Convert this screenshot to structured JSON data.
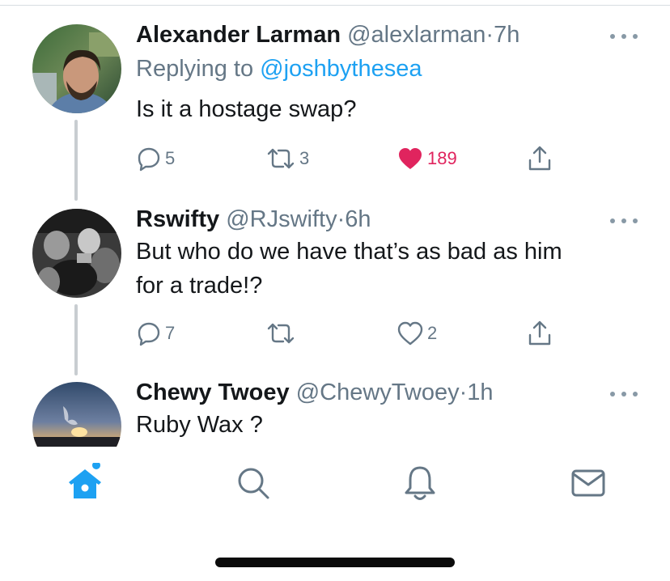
{
  "tweets": [
    {
      "name": "Alexander Larman",
      "handle": "@alexlarman",
      "separator": "·",
      "time": "7h",
      "replying_label": "Replying to",
      "replying_to": "@joshbythesea",
      "text": "Is it a hostage swap?",
      "replies": "5",
      "retweets": "3",
      "likes": "189",
      "liked": true,
      "avatar_icon": "person-photo-avatar"
    },
    {
      "name": "Rswifty",
      "handle": "@RJswifty",
      "separator": "·",
      "time": "6h",
      "text_line1": "But who do we have that’s as bad as him",
      "text_line2": "for a trade!?",
      "replies": "7",
      "retweets": "",
      "likes": "2",
      "liked": false,
      "avatar_icon": "grayscale-photo-avatar"
    },
    {
      "name": "Chewy Twoey",
      "handle": "@ChewyTwoey",
      "separator": "·",
      "time": "1h",
      "text": "Ruby Wax ?",
      "avatar_icon": "sunset-photo-avatar"
    }
  ],
  "tabbar": {
    "items": [
      "home-icon",
      "search-icon",
      "notifications-icon",
      "messages-icon"
    ],
    "active": "home-icon",
    "has_new_dot": true
  },
  "colors": {
    "accent": "#1da1f2",
    "like": "#e0245e",
    "muted": "#657786"
  }
}
